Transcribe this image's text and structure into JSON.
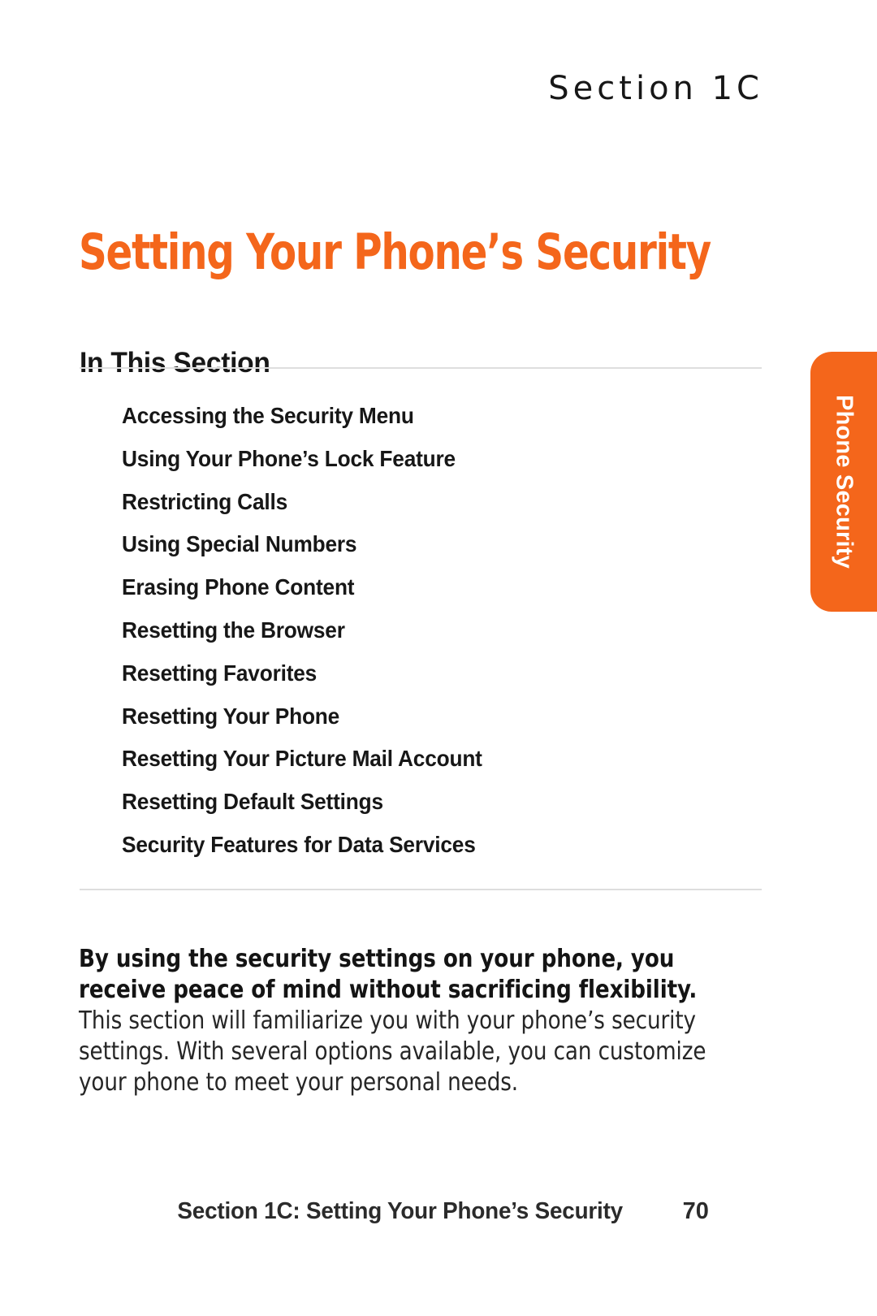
{
  "document": {
    "section_eyebrow": "Section 1C",
    "title": "Setting Your Phone’s Security",
    "accent_color": "#F4661B",
    "text_color": "#171717",
    "rule_color": "#DEDEDE",
    "background_color": "#FFFFFF"
  },
  "in_this_section": {
    "heading": "In This Section",
    "items": [
      "Accessing the Security Menu",
      "Using Your Phone’s Lock Feature",
      "Restricting Calls",
      "Using Special Numbers",
      "Erasing Phone Content",
      "Resetting the Browser",
      "Resetting Favorites",
      "Resetting Your Phone",
      "Resetting Your Picture Mail Account",
      "Resetting Default Settings",
      "Security Features for Data Services"
    ]
  },
  "body": {
    "lead": "By using the security settings on your phone, you receive peace of mind without sacrificing flexibility.",
    "rest": " This section will familiarize you with your phone’s security settings. With several options available, you can customize your phone to meet your personal needs."
  },
  "side_tab": {
    "label": "Phone Security",
    "color": "#F4661B"
  },
  "footer": {
    "title": "Section 1C: Setting Your Phone’s Security",
    "page_number": "70"
  }
}
